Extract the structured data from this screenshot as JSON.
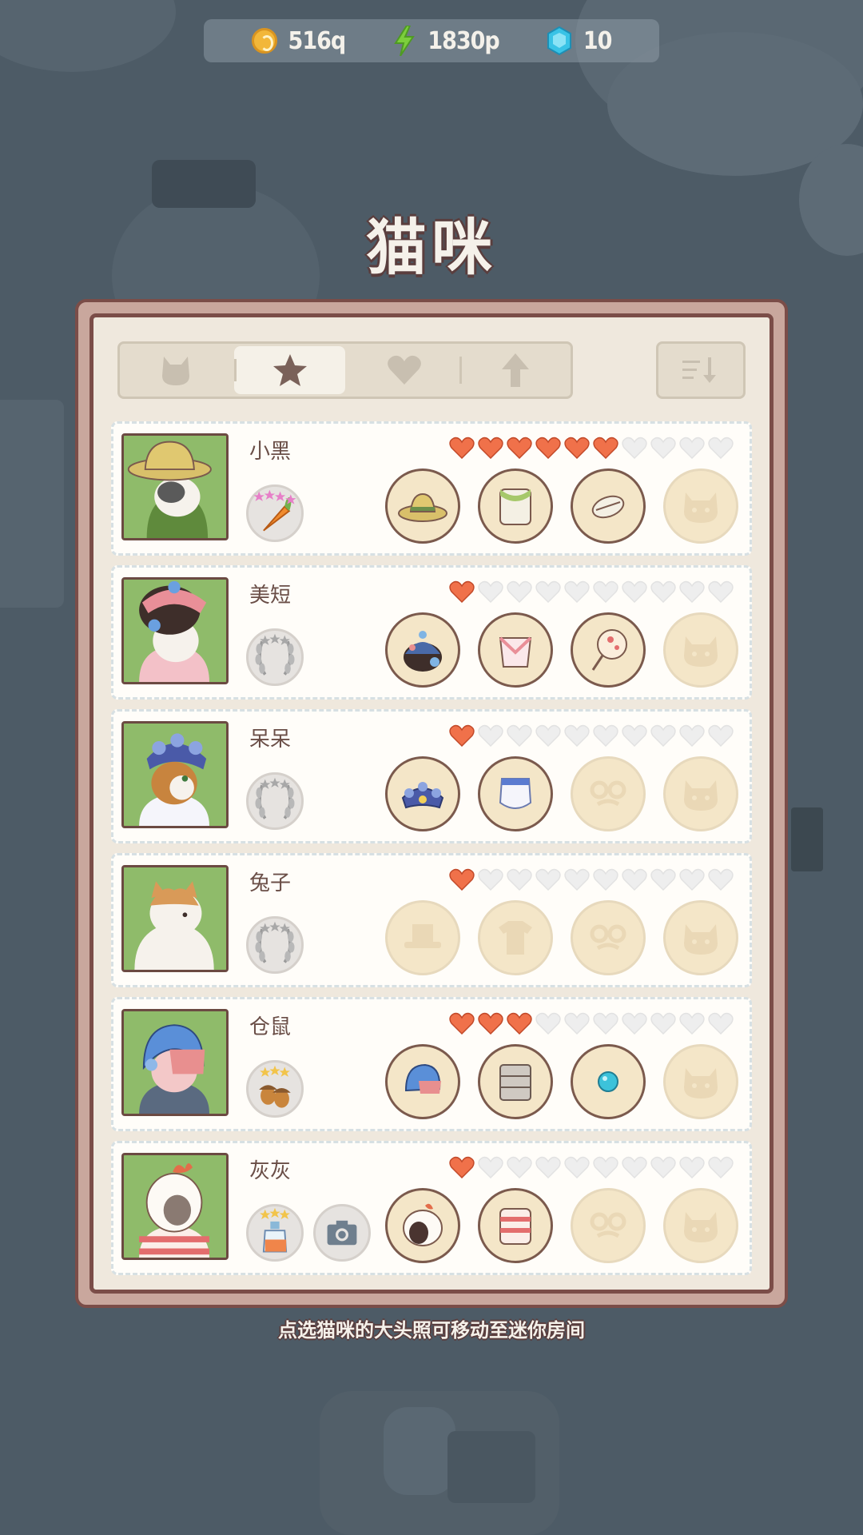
{
  "currency": {
    "coins": "516q",
    "energy": "1830p",
    "gems": "10"
  },
  "title": "猫咪",
  "tabs": [
    {
      "icon": "cat-icon",
      "active": false
    },
    {
      "icon": "star-icon",
      "active": true
    },
    {
      "icon": "heart-icon",
      "active": false
    },
    {
      "icon": "arrow-up-icon",
      "active": false
    }
  ],
  "sort_icon": "sort-icon",
  "cats": [
    {
      "name": "小黑",
      "hearts": 6,
      "max_hearts": 10,
      "badge": "carrot-badge",
      "extra_badge": null,
      "items": [
        "straw-hat",
        "green-shirt",
        "fish-bone",
        "locked-slot"
      ]
    },
    {
      "name": "美短",
      "hearts": 1,
      "max_hearts": 10,
      "badge": "laurel-badge",
      "extra_badge": null,
      "items": [
        "opera-headdress",
        "pink-collar",
        "hand-fan",
        "locked-slot"
      ]
    },
    {
      "name": "呆呆",
      "hearts": 1,
      "max_hearts": 10,
      "badge": "laurel-badge",
      "extra_badge": null,
      "items": [
        "blue-crown",
        "white-bib",
        "locked-glasses",
        "locked-slot"
      ]
    },
    {
      "name": "兔子",
      "hearts": 1,
      "max_hearts": 10,
      "badge": "laurel-badge",
      "extra_badge": null,
      "items": [
        "locked-hat",
        "locked-shirt",
        "locked-glasses",
        "locked-slot"
      ]
    },
    {
      "name": "仓鼠",
      "hearts": 3,
      "max_hearts": 10,
      "badge": "acorn-badge",
      "extra_badge": null,
      "items": [
        "blue-helmet",
        "armor-vest",
        "blue-bead",
        "locked-slot"
      ]
    },
    {
      "name": "灰灰",
      "hearts": 1,
      "max_hearts": 10,
      "badge": "bottle-badge",
      "extra_badge": "camera-icon",
      "items": [
        "chicken-hood",
        "striped-shirt",
        "locked-glasses",
        "locked-slot"
      ]
    }
  ],
  "hint": "点选猫咪的大头照可移动至迷你房间",
  "colors": {
    "heart_filled": "#f0714a",
    "heart_empty": "#eeeeee",
    "avatar_bg": "#8fbb6a",
    "panel_border": "#7b4d48"
  }
}
